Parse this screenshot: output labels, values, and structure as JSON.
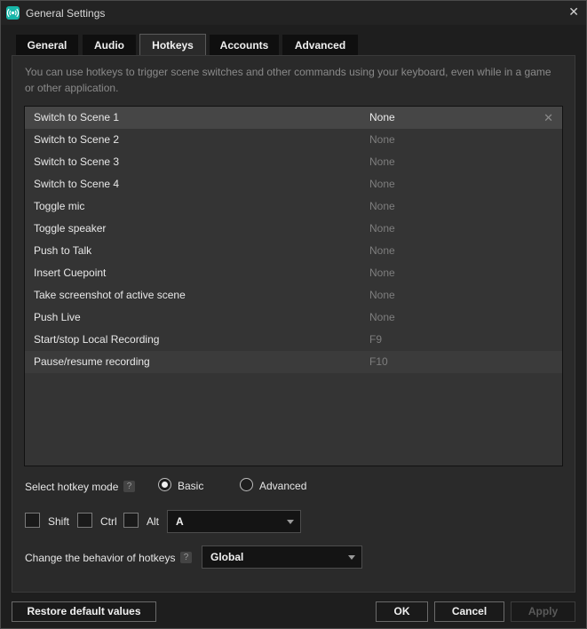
{
  "window": {
    "title": "General Settings"
  },
  "tabs": [
    {
      "label": "General"
    },
    {
      "label": "Audio"
    },
    {
      "label": "Hotkeys"
    },
    {
      "label": "Accounts"
    },
    {
      "label": "Advanced"
    }
  ],
  "active_tab": "Hotkeys",
  "description": "You can use hotkeys to trigger scene switches and other commands using your keyboard, even while in a game or other application.",
  "hotkeys": [
    {
      "name": "Switch to Scene 1",
      "key": "None"
    },
    {
      "name": "Switch to Scene 2",
      "key": "None"
    },
    {
      "name": "Switch to Scene 3",
      "key": "None"
    },
    {
      "name": "Switch to Scene 4",
      "key": "None"
    },
    {
      "name": "Toggle mic",
      "key": "None"
    },
    {
      "name": "Toggle speaker",
      "key": "None"
    },
    {
      "name": "Push to Talk",
      "key": "None"
    },
    {
      "name": "Insert Cuepoint",
      "key": "None"
    },
    {
      "name": "Take screenshot of active scene",
      "key": "None"
    },
    {
      "name": "Push Live",
      "key": "None"
    },
    {
      "name": "Start/stop Local Recording",
      "key": "F9"
    },
    {
      "name": "Pause/resume recording",
      "key": "F10"
    }
  ],
  "hotkey_mode": {
    "label": "Select hotkey mode",
    "help": "?",
    "options": [
      "Basic",
      "Advanced"
    ],
    "selected": "Basic"
  },
  "modifiers": {
    "shift": "Shift",
    "ctrl": "Ctrl",
    "alt": "Alt",
    "key_value": "A"
  },
  "behavior": {
    "label": "Change the behavior of hotkeys",
    "help": "?",
    "value": "Global"
  },
  "buttons": {
    "restore": "Restore default values",
    "ok": "OK",
    "cancel": "Cancel",
    "apply": "Apply"
  },
  "colors": {
    "accent": "#17b6a8",
    "background": "#1e1e1e",
    "panel": "#2a2a2a"
  }
}
